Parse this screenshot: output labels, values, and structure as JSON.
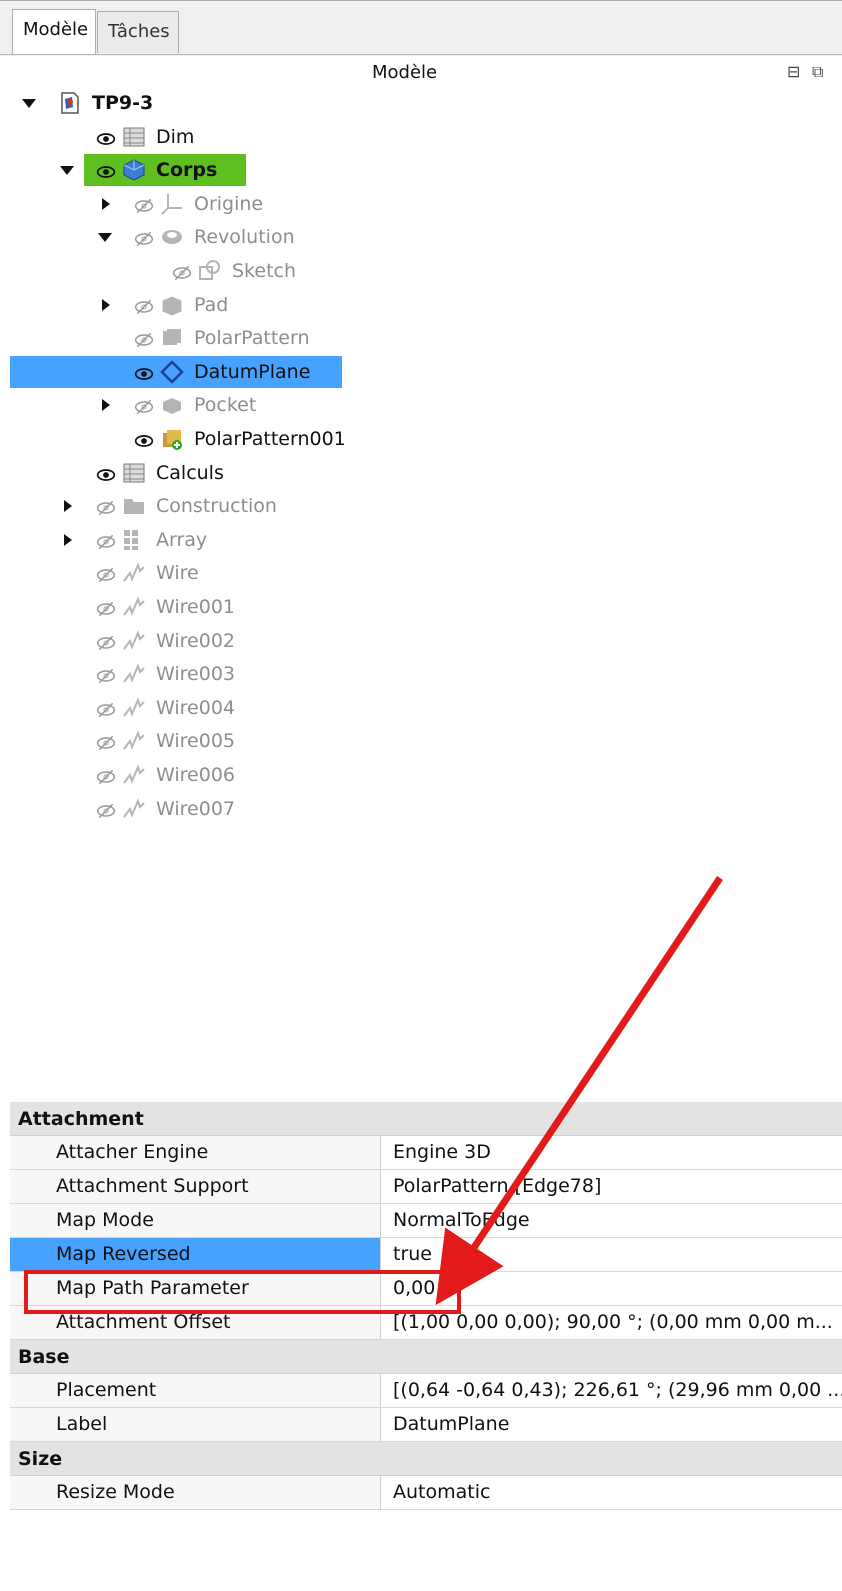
{
  "tabs": [
    {
      "label": "Modèle",
      "active": true
    },
    {
      "label": "Tâches",
      "active": false
    }
  ],
  "tree_header": {
    "title": "Modèle"
  },
  "tree": [
    {
      "label": "TP9-3",
      "indent": 0,
      "expand": "down",
      "eye": "none",
      "icon": "document-icon",
      "bold": true,
      "dim": false
    },
    {
      "label": "Dim",
      "indent": 1,
      "expand": "none",
      "eye": "visible",
      "icon": "spreadsheet-icon",
      "bold": false,
      "dim": false
    },
    {
      "label": "Corps",
      "indent": 1,
      "expand": "down",
      "eye": "visible",
      "icon": "body-icon",
      "bold": true,
      "dim": false,
      "highlight": "green"
    },
    {
      "label": "Origine",
      "indent": 2,
      "expand": "right",
      "eye": "hidden",
      "icon": "origin-axis-icon",
      "bold": false,
      "dim": true
    },
    {
      "label": "Revolution",
      "indent": 2,
      "expand": "down",
      "eye": "hidden",
      "icon": "revolution-icon",
      "bold": false,
      "dim": true
    },
    {
      "label": "Sketch",
      "indent": 3,
      "expand": "none",
      "eye": "hidden",
      "icon": "sketch-icon",
      "bold": false,
      "dim": true
    },
    {
      "label": "Pad",
      "indent": 2,
      "expand": "right",
      "eye": "hidden",
      "icon": "pad-icon",
      "bold": false,
      "dim": true
    },
    {
      "label": "PolarPattern",
      "indent": 2,
      "expand": "none",
      "eye": "hidden",
      "icon": "polar-pattern-icon",
      "bold": false,
      "dim": true
    },
    {
      "label": "DatumPlane",
      "indent": 2,
      "expand": "none",
      "eye": "visible",
      "icon": "datum-plane-icon",
      "bold": false,
      "dim": false,
      "highlight": "blue"
    },
    {
      "label": "Pocket",
      "indent": 2,
      "expand": "right",
      "eye": "hidden",
      "icon": "pocket-icon",
      "bold": false,
      "dim": true
    },
    {
      "label": "PolarPattern001",
      "indent": 2,
      "expand": "none",
      "eye": "visible",
      "icon": "polar-pattern-tip-icon",
      "bold": false,
      "dim": false
    },
    {
      "label": "Calculs",
      "indent": 1,
      "expand": "none",
      "eye": "visible",
      "icon": "spreadsheet-icon",
      "bold": false,
      "dim": false
    },
    {
      "label": "Construction",
      "indent": 1,
      "expand": "right",
      "eye": "hidden",
      "icon": "folder-icon",
      "bold": false,
      "dim": true
    },
    {
      "label": "Array",
      "indent": 1,
      "expand": "right",
      "eye": "hidden",
      "icon": "array-icon",
      "bold": false,
      "dim": true
    },
    {
      "label": "Wire",
      "indent": 1,
      "expand": "none",
      "eye": "hidden",
      "icon": "wire-icon",
      "bold": false,
      "dim": true
    },
    {
      "label": "Wire001",
      "indent": 1,
      "expand": "none",
      "eye": "hidden",
      "icon": "wire-icon",
      "bold": false,
      "dim": true
    },
    {
      "label": "Wire002",
      "indent": 1,
      "expand": "none",
      "eye": "hidden",
      "icon": "wire-icon",
      "bold": false,
      "dim": true
    },
    {
      "label": "Wire003",
      "indent": 1,
      "expand": "none",
      "eye": "hidden",
      "icon": "wire-icon",
      "bold": false,
      "dim": true
    },
    {
      "label": "Wire004",
      "indent": 1,
      "expand": "none",
      "eye": "hidden",
      "icon": "wire-icon",
      "bold": false,
      "dim": true
    },
    {
      "label": "Wire005",
      "indent": 1,
      "expand": "none",
      "eye": "hidden",
      "icon": "wire-icon",
      "bold": false,
      "dim": true
    },
    {
      "label": "Wire006",
      "indent": 1,
      "expand": "none",
      "eye": "hidden",
      "icon": "wire-icon",
      "bold": false,
      "dim": true
    },
    {
      "label": "Wire007",
      "indent": 1,
      "expand": "none",
      "eye": "hidden",
      "icon": "wire-icon",
      "bold": false,
      "dim": true
    }
  ],
  "properties": {
    "groups": [
      {
        "name": "Attachment",
        "rows": [
          {
            "name": "Attacher Engine",
            "value": "Engine 3D",
            "expandable": false
          },
          {
            "name": "Attachment Support",
            "value": "PolarPattern [Edge78]",
            "expandable": false
          },
          {
            "name": "Map Mode",
            "value": "NormalToEdge",
            "expandable": false
          },
          {
            "name": "Map Reversed",
            "value": "true",
            "expandable": false,
            "selected": true
          },
          {
            "name": "Map Path Parameter",
            "value": "0,00",
            "expandable": false
          },
          {
            "name": "Attachment Offset",
            "value": "[(1,00 0,00 0,00); 90,00 °; (0,00 mm  0,00 m...",
            "expandable": true
          }
        ]
      },
      {
        "name": "Base",
        "rows": [
          {
            "name": "Placement",
            "value": "[(0,64 -0,64 0,43); 226,61 °; (29,96 mm  0,00 ...",
            "expandable": true
          },
          {
            "name": "Label",
            "value": "DatumPlane",
            "expandable": false
          }
        ]
      },
      {
        "name": "Size",
        "rows": [
          {
            "name": "Resize Mode",
            "value": "Automatic",
            "expandable": false
          }
        ]
      }
    ]
  },
  "colors": {
    "selection": "#46a1ff",
    "active_body": "#5fbf21",
    "annotation": "#e21a1a"
  }
}
